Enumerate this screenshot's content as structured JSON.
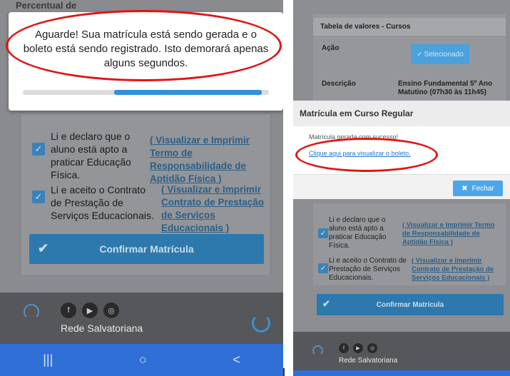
{
  "left": {
    "top_cut_text": "Percentual de",
    "loading_message": "Aguarde! Sua matrícula está sendo gerada e o boleto está sendo registrado. Isto demorará apenas alguns segundos.",
    "progress": 0.6,
    "check1_text": "Li e declaro que o aluno está apto a praticar Educação Física.",
    "check1_link": "( Visualizar e Imprimir Termo de Responsabilidade de Aptidão Física )",
    "check2_text": "Li e aceito o Contrato de Prestação de Serviços Educacionais.",
    "check2_link": "( Visualizar e Imprimir Contrato de Prestação de Serviços Educacionais )",
    "confirm_label": "Confirmar Matrícula",
    "footer_label": "Rede Salvatoriana",
    "social": [
      "facebook-icon",
      "youtube-icon",
      "instagram-icon"
    ],
    "nav": [
      "|||",
      "○",
      "<"
    ]
  },
  "right": {
    "table_title": "Tabela de valores - Cursos",
    "acao_label": "Ação",
    "selected_label": "Selecionado",
    "descricao_label": "Descrição",
    "descricao_value_line1": "Ensino Fundamental 5º Ano",
    "descricao_value_line2": "Matutino (07h30 às 11h45)",
    "modal_title": "Matrícula em Curso Regular",
    "modal_body": "Matrícula gerada com sucesso!",
    "modal_link": "Clique aqui para visualizar o boleto.",
    "close_label": "Fechar",
    "check1_text": "Li e declaro que o aluno está apto a praticar Educação Física.",
    "check1_link": "( Visualizar e Imprimir Termo de Responsabilidade de Aptidão Física )",
    "check2_text": "Li e aceito o Contrato de Prestação de Serviços Educacionais.",
    "check2_link": "( Visualizar e Imprimir Contrato de Prestação de Serviços Educacionais )",
    "confirm_label": "Confirmar Matrícula",
    "footer_label": "Rede Salvatoriana"
  },
  "colors": {
    "highlight": "#e01515",
    "accent": "#2f8fe0",
    "nav": "#2f6fd6"
  }
}
